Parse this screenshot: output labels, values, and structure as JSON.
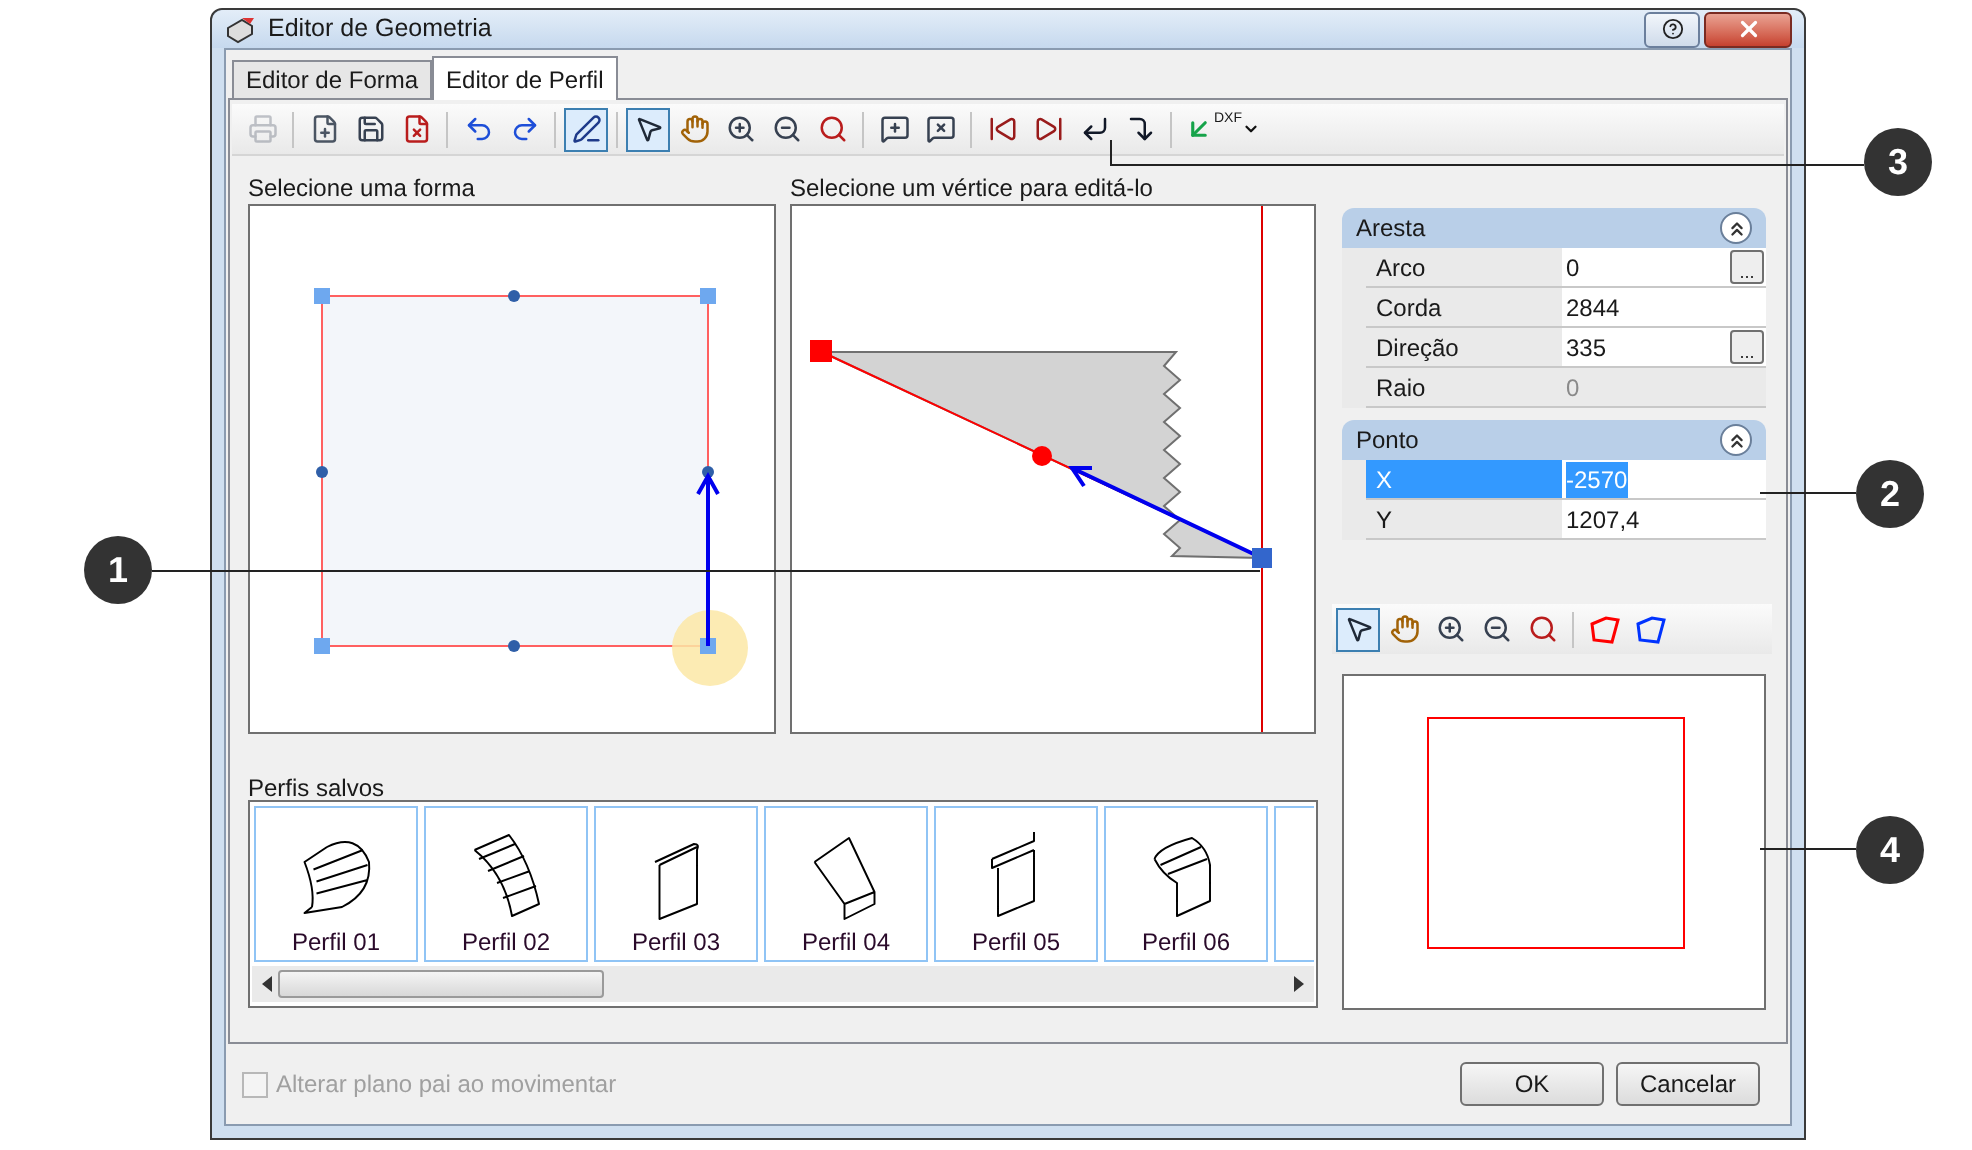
{
  "window": {
    "title": "Editor de Geometria"
  },
  "tabs": [
    {
      "label": "Editor de Forma",
      "selected": false
    },
    {
      "label": "Editor de Perfil",
      "selected": true
    }
  ],
  "toolbar": [
    {
      "kind": "button",
      "selected": false,
      "disabled": true
    },
    {
      "kind": "separator"
    },
    {
      "kind": "button",
      "selected": false,
      "disabled": false
    },
    {
      "kind": "button",
      "selected": false,
      "disabled": false
    },
    {
      "kind": "button",
      "selected": false,
      "disabled": false
    },
    {
      "kind": "separator"
    },
    {
      "kind": "button",
      "selected": false,
      "disabled": false
    },
    {
      "kind": "button",
      "selected": false,
      "disabled": false
    },
    {
      "kind": "separator"
    },
    {
      "kind": "button",
      "selected": true,
      "disabled": false
    },
    {
      "kind": "separator"
    },
    {
      "kind": "button",
      "selected": true,
      "disabled": false
    },
    {
      "kind": "button",
      "selected": false,
      "disabled": false
    },
    {
      "kind": "button",
      "selected": false,
      "disabled": false
    },
    {
      "kind": "button",
      "selected": false,
      "disabled": false
    },
    {
      "kind": "button",
      "selected": false,
      "disabled": false
    },
    {
      "kind": "separator"
    },
    {
      "kind": "button",
      "selected": false,
      "disabled": false
    },
    {
      "kind": "button",
      "selected": false,
      "disabled": false
    },
    {
      "kind": "separator"
    },
    {
      "kind": "button",
      "selected": false,
      "disabled": false
    },
    {
      "kind": "button",
      "selected": false,
      "disabled": false
    },
    {
      "kind": "button",
      "selected": false,
      "disabled": false
    },
    {
      "kind": "button",
      "selected": false,
      "disabled": false
    },
    {
      "kind": "separator"
    },
    {
      "kind": "dxf",
      "label": "DXF"
    }
  ],
  "shape_panel": {
    "label": "Selecione uma forma"
  },
  "vertex_panel": {
    "label": "Selecione um vértice para editá-lo"
  },
  "properties": [
    {
      "title": "Aresta",
      "expanded": true,
      "rows": [
        {
          "label": "Arco",
          "value": "0",
          "button": "...",
          "readonly": false,
          "selected": false
        },
        {
          "label": "Corda",
          "value": "2844",
          "readonly": false,
          "selected": false
        },
        {
          "label": "Direção",
          "value": "335",
          "button": "...",
          "readonly": false,
          "selected": false
        },
        {
          "label": "Raio",
          "value": "0",
          "readonly": true,
          "selected": false
        }
      ]
    },
    {
      "title": "Ponto",
      "expanded": true,
      "rows": [
        {
          "label": "X",
          "value": "-2570",
          "readonly": false,
          "selected": true
        },
        {
          "label": "Y",
          "value": "1207,4",
          "readonly": false,
          "selected": false
        }
      ]
    }
  ],
  "preview_toolbar": [
    {
      "kind": "button",
      "selected": true
    },
    {
      "kind": "button",
      "selected": false
    },
    {
      "kind": "button",
      "selected": false
    },
    {
      "kind": "button",
      "selected": false
    },
    {
      "kind": "button",
      "selected": false
    },
    {
      "kind": "separator"
    },
    {
      "kind": "shape",
      "color": "#ff0000",
      "selected": false
    },
    {
      "kind": "shape",
      "color": "#0033ff",
      "selected": false
    }
  ],
  "saved_profiles": {
    "label": "Perfis salvos",
    "items": [
      {
        "name": "Perfil 01"
      },
      {
        "name": "Perfil 02"
      },
      {
        "name": "Perfil 03"
      },
      {
        "name": "Perfil 04"
      },
      {
        "name": "Perfil 05"
      },
      {
        "name": "Perfil 06"
      }
    ]
  },
  "option": {
    "label": "Alterar plano pai ao movimentar",
    "checked": false,
    "disabled": true
  },
  "buttons": [
    "OK",
    "Cancelar"
  ],
  "callouts": [
    "3",
    "2",
    "1",
    "4"
  ]
}
